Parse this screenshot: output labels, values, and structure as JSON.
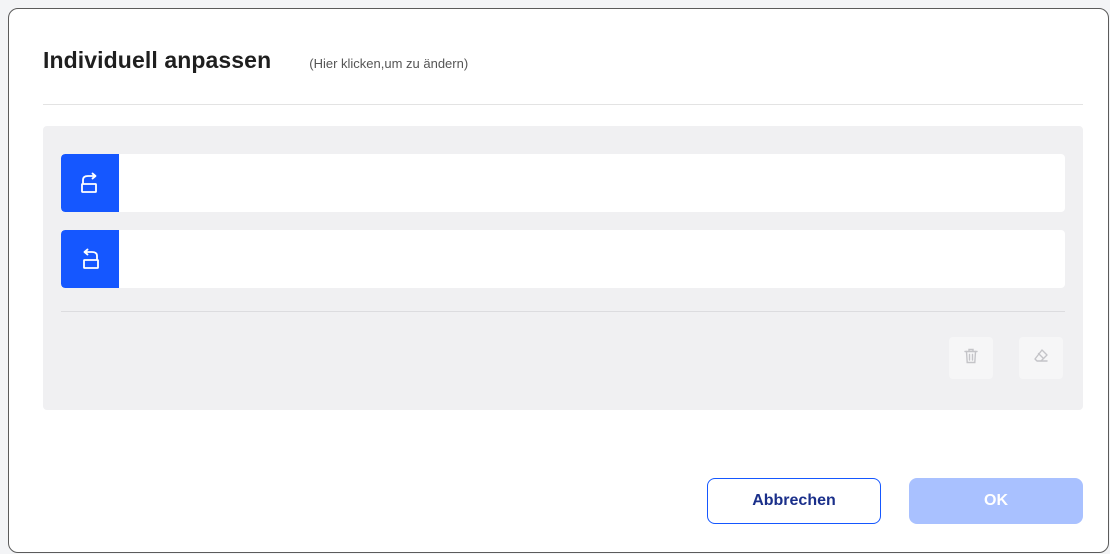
{
  "dialog": {
    "title": "Individuell anpassen",
    "hint": "(Hier klicken,um zu ändern)"
  },
  "rows": [
    {
      "icon": "rotate-clockwise-icon",
      "value": ""
    },
    {
      "icon": "rotate-counterclockwise-icon",
      "value": ""
    }
  ],
  "tools": {
    "delete_icon": "trash-icon",
    "clear_icon": "eraser-icon"
  },
  "buttons": {
    "cancel_label": "Abbrechen",
    "ok_label": "OK"
  },
  "colors": {
    "accent": "#1557ff",
    "ok_disabled": "#a9c1ff",
    "panel_bg": "#f0f0f2"
  }
}
